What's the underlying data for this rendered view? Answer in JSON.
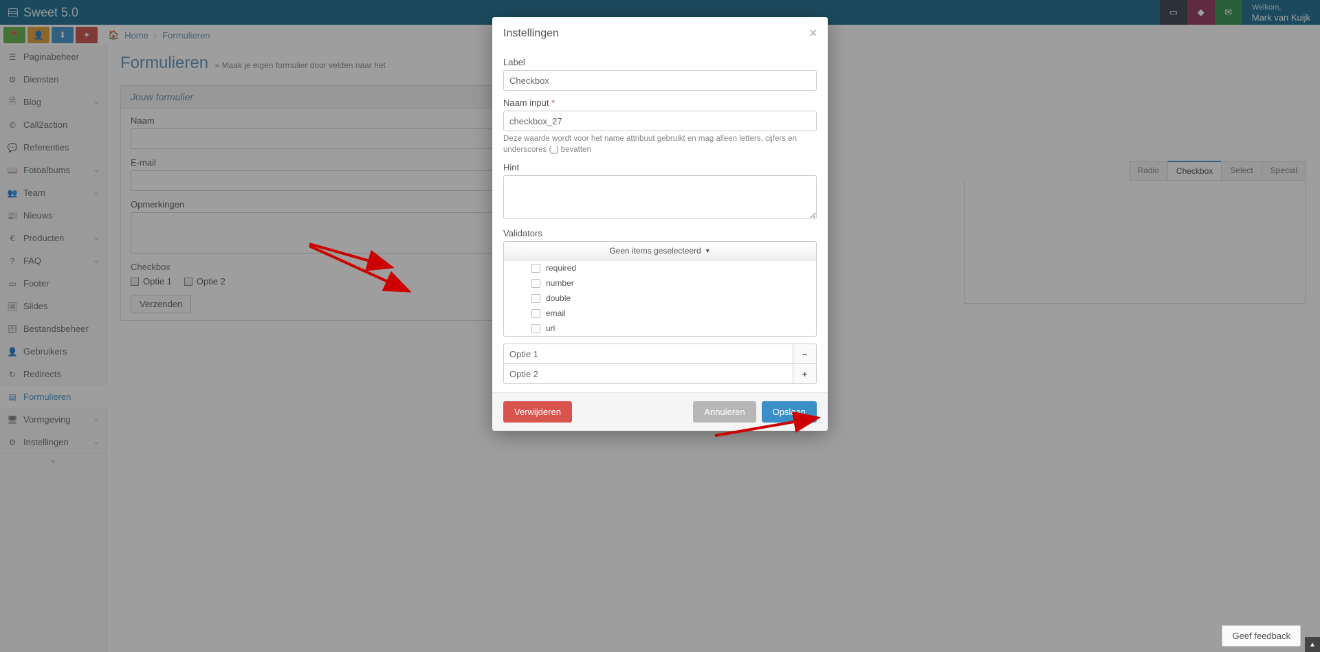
{
  "app": {
    "brand": "Sweet 5.0"
  },
  "topbar": {
    "welcome_label": "Welkom,",
    "user_name": "Mark van Kuijk"
  },
  "breadcrumbs": {
    "home": "Home",
    "current": "Formulieren"
  },
  "sidebar": {
    "items": [
      {
        "label": "Paginabeheer",
        "icon": "☰"
      },
      {
        "label": "Diensten",
        "icon": "⚙"
      },
      {
        "label": "Blog",
        "icon": "🗎",
        "chev": true
      },
      {
        "label": "Call2action",
        "icon": "✆"
      },
      {
        "label": "Referenties",
        "icon": "💬"
      },
      {
        "label": "Fotoalbums",
        "icon": "📖",
        "chev": true
      },
      {
        "label": "Team",
        "icon": "👥",
        "chev": true
      },
      {
        "label": "Nieuws",
        "icon": "📰"
      },
      {
        "label": "Producten",
        "icon": "€",
        "chev": true
      },
      {
        "label": "FAQ",
        "icon": "?",
        "chev": true
      },
      {
        "label": "Footer",
        "icon": "▭"
      },
      {
        "label": "Slides",
        "icon": "🖼"
      },
      {
        "label": "Bestandsbeheer",
        "icon": "🗄"
      },
      {
        "label": "Gebruikers",
        "icon": "👤"
      },
      {
        "label": "Redirects",
        "icon": "↻"
      },
      {
        "label": "Formulieren",
        "icon": "▤",
        "active": true
      },
      {
        "label": "Vormgeving",
        "icon": "🖥",
        "chev": true
      },
      {
        "label": "Instellingen",
        "icon": "⚙",
        "chev": true
      }
    ],
    "collapse_glyph": "«"
  },
  "page": {
    "title": "Formulieren",
    "sub": "» Maak je eigen formulier door velden naar het",
    "panel_title": "Jouw formulier",
    "fields": {
      "name": "Naam",
      "email": "E-mail",
      "notes": "Opmerkingen",
      "checkbox": "Checkbox",
      "opt1": "Optie 1",
      "opt2": "Optie 2",
      "submit": "Verzenden"
    }
  },
  "tabs": {
    "items": [
      "Radio",
      "Checkbox",
      "Select",
      "Special"
    ],
    "active": 1
  },
  "modal": {
    "title": "Instellingen",
    "labels": {
      "label": "Label",
      "name": "Naam input",
      "req": "*",
      "hint": "Hint",
      "validators": "Validators"
    },
    "values": {
      "label": "Checkbox",
      "name": "checkbox_27"
    },
    "name_hint": "Deze waarde wordt voor het name attribuut gebruikt en mag alleen letters, cijfers en underscores (_) bevatten",
    "validators_placeholder": "Geen items geselecteerd",
    "validators": [
      "required",
      "number",
      "double",
      "email",
      "url"
    ],
    "options": [
      "Optie 1",
      "Optie 2"
    ],
    "buttons": {
      "delete": "Verwijderen",
      "cancel": "Annuleren",
      "save": "Opslaan"
    }
  },
  "footer": {
    "feedback": "Geef feedback"
  }
}
